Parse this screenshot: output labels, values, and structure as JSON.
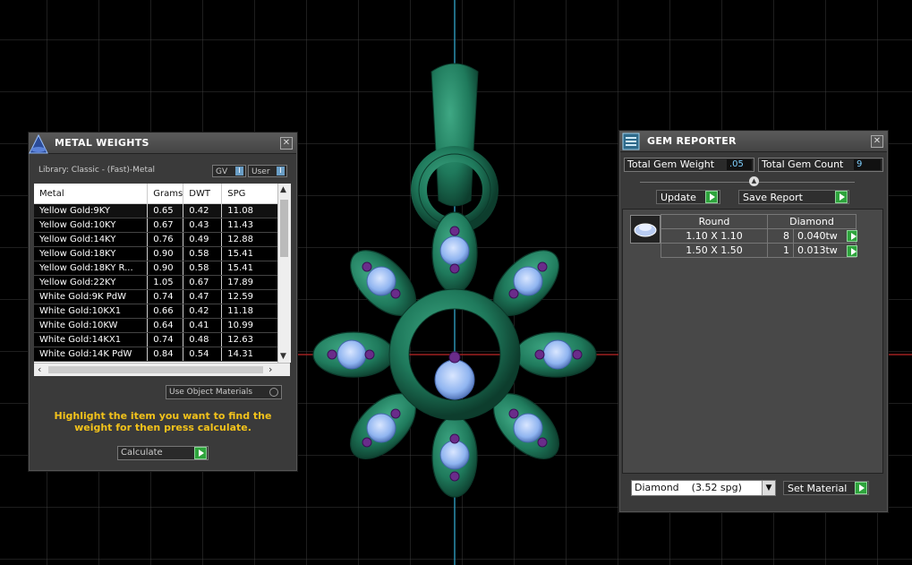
{
  "metal_weights": {
    "title": "METAL WEIGHTS",
    "library": "Library: Classic - (Fast)-Metal",
    "gv_label": "GV",
    "user_label": "User",
    "columns": [
      "Metal",
      "Grams",
      "DWT",
      "SPG"
    ],
    "rows": [
      [
        "Yellow Gold:9KY",
        "0.65",
        "0.42",
        "11.08"
      ],
      [
        "Yellow Gold:10KY",
        "0.67",
        "0.43",
        "11.43"
      ],
      [
        "Yellow Gold:14KY",
        "0.76",
        "0.49",
        "12.88"
      ],
      [
        "Yellow Gold:18KY",
        "0.90",
        "0.58",
        "15.41"
      ],
      [
        "Yellow Gold:18KY R...",
        "0.90",
        "0.58",
        "15.41"
      ],
      [
        "Yellow Gold:22KY",
        "1.05",
        "0.67",
        "17.89"
      ],
      [
        "White Gold:9K PdW",
        "0.74",
        "0.47",
        "12.59"
      ],
      [
        "White Gold:10KX1",
        "0.66",
        "0.42",
        "11.18"
      ],
      [
        "White Gold:10KW",
        "0.64",
        "0.41",
        "10.99"
      ],
      [
        "White Gold:14KX1",
        "0.74",
        "0.48",
        "12.63"
      ],
      [
        "White Gold:14K PdW",
        "0.84",
        "0.54",
        "14.31"
      ]
    ],
    "use_object_materials": "Use Object Materials",
    "hint": "Highlight the item you want to find the weight for then press calculate.",
    "calculate": "Calculate"
  },
  "gem_reporter": {
    "title": "GEM REPORTER",
    "total_weight_label": "Total Gem Weight",
    "total_weight_value": ".05",
    "total_count_label": "Total Gem Count",
    "total_count_value": "9",
    "update": "Update",
    "save_report": "Save Report",
    "shape": "Round",
    "material": "Diamond",
    "gems": [
      {
        "size": "1.10 X 1.10",
        "count": "8",
        "weight": "0.040tw"
      },
      {
        "size": "1.50 X 1.50",
        "count": "1",
        "weight": "0.013tw"
      }
    ],
    "material_select": "Diamond    (3.52 spg)",
    "set_material": "Set Material"
  },
  "colors": {
    "metal": "#1f7a5c",
    "gem": "#8fb4f0",
    "gem_accent": "#6a2c8a",
    "accent_green": "#2ea43c",
    "hint_yellow": "#f2c21b"
  }
}
